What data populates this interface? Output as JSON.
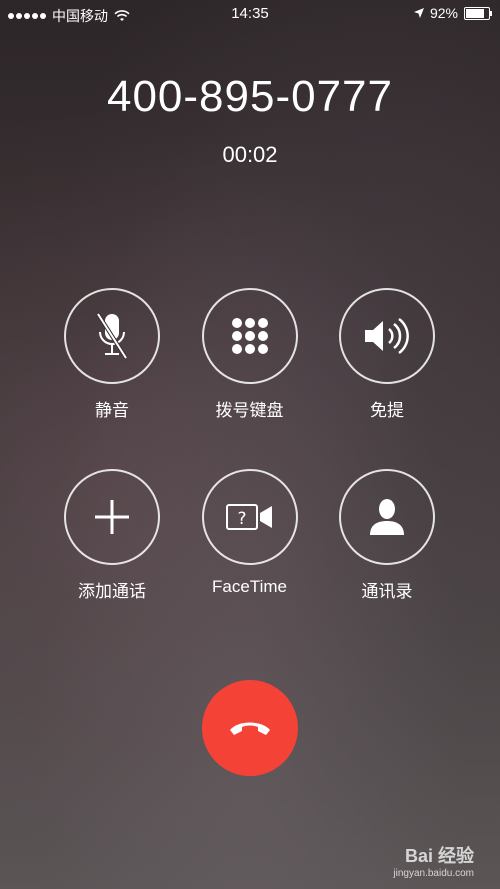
{
  "status_bar": {
    "carrier": "中国移动",
    "time": "14:35",
    "battery_text": "92%",
    "battery_level": 0.92
  },
  "call": {
    "number": "400-895-0777",
    "duration": "00:02"
  },
  "controls": [
    {
      "label": "静音",
      "icon": "mic-muted-icon"
    },
    {
      "label": "拨号键盘",
      "icon": "keypad-icon"
    },
    {
      "label": "免提",
      "icon": "speaker-icon"
    },
    {
      "label": "添加通话",
      "icon": "plus-icon"
    },
    {
      "label": "FaceTime",
      "icon": "facetime-icon"
    },
    {
      "label": "通讯录",
      "icon": "contact-icon"
    }
  ],
  "end_call": {
    "icon": "end-call-icon",
    "color": "#f44336"
  },
  "watermark": {
    "brand": "Bai 经验",
    "sub": "jingyan.baidu.com"
  }
}
